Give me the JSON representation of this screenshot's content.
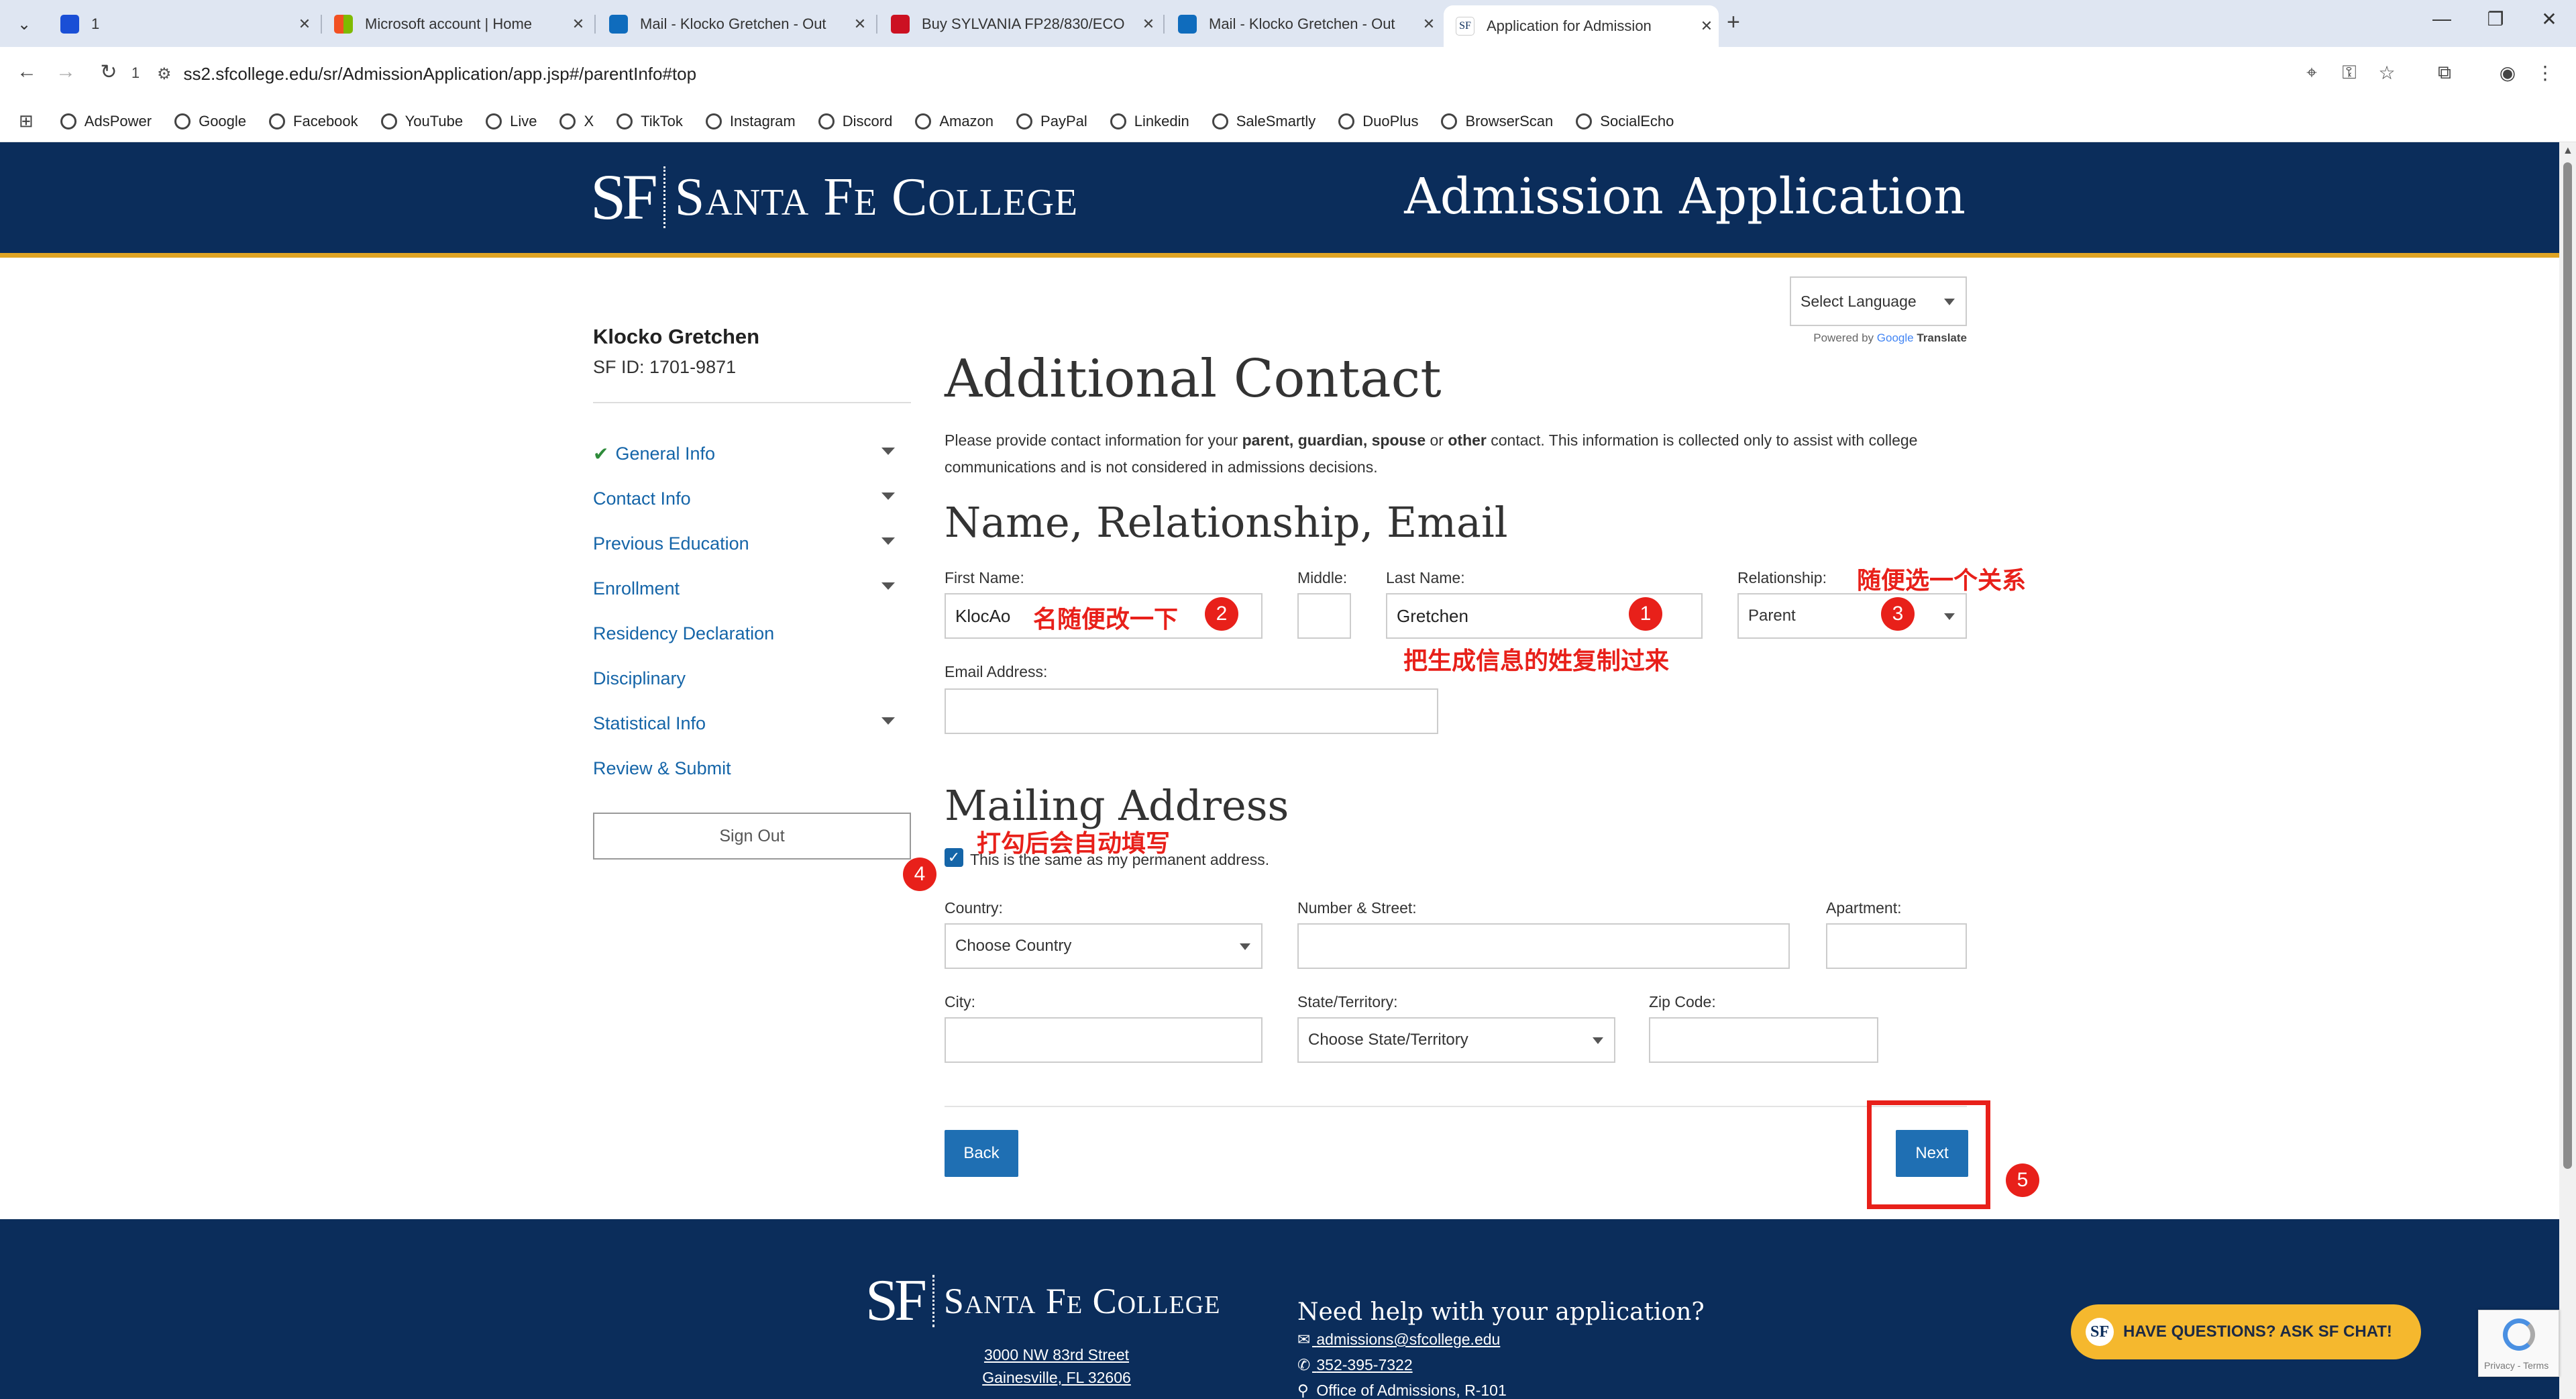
{
  "browser": {
    "tabs": [
      {
        "title": "1",
        "favicon_color": "#1a4fd6"
      },
      {
        "title": "Microsoft account | Home",
        "favicon_color": "#f25022"
      },
      {
        "title": "Mail - Klocko Gretchen - Out",
        "favicon_color": "#0f6cbd"
      },
      {
        "title": "Buy SYLVANIA FP28/830/ECO",
        "favicon_color": "#cc1122"
      },
      {
        "title": "Mail - Klocko Gretchen - Out",
        "favicon_color": "#0f6cbd"
      },
      {
        "title": "Application for Admission",
        "favicon_color": "#ffffff"
      }
    ],
    "url": "ss2.sfcollege.edu/sr/AdmissionApplication/app.jsp#/parentInfo#top",
    "reload_count": "1",
    "bookmarks": [
      "AdsPower",
      "Google",
      "Facebook",
      "YouTube",
      "Live",
      "X",
      "TikTok",
      "Instagram",
      "Discord",
      "Amazon",
      "PayPal",
      "Linkedin",
      "SaleSmartly",
      "DuoPlus",
      "BrowserScan",
      "SocialEcho"
    ]
  },
  "header": {
    "logo_mark": "SF",
    "logo_name": "Santa Fe College",
    "title": "Admission Application"
  },
  "sidebar": {
    "user_name": "Klocko Gretchen",
    "sf_id": "SF ID: 1701-9871",
    "items": [
      {
        "label": "General Info",
        "done": true,
        "expandable": true
      },
      {
        "label": "Contact Info",
        "done": false,
        "expandable": true
      },
      {
        "label": "Previous Education",
        "done": false,
        "expandable": true
      },
      {
        "label": "Enrollment",
        "done": false,
        "expandable": true
      },
      {
        "label": "Residency Declaration",
        "done": false,
        "expandable": false
      },
      {
        "label": "Disciplinary",
        "done": false,
        "expandable": false
      },
      {
        "label": "Statistical Info",
        "done": false,
        "expandable": true
      },
      {
        "label": "Review & Submit",
        "done": false,
        "expandable": false
      }
    ],
    "sign_out": "Sign Out"
  },
  "translate": {
    "select_label": "Select Language",
    "powered_by": "Powered by",
    "google": "Google",
    "translate": "Translate"
  },
  "main": {
    "title": "Additional Contact",
    "intro_prefix": "Please provide contact information for your ",
    "intro_b1": "parent, guardian, spouse",
    "intro_mid": " or ",
    "intro_b2": "other",
    "intro_suffix": " contact. This information is collected only to assist with college communications and is not considered in admissions decisions.",
    "section1": "Name, Relationship, Email",
    "first_name_label": "First Name:",
    "first_name_value": "KlocAo",
    "middle_label": "Middle:",
    "middle_value": "",
    "last_name_label": "Last Name:",
    "last_name_value": "Gretchen",
    "relationship_label": "Relationship:",
    "relationship_value": "Parent",
    "email_label": "Email Address:",
    "email_value": "",
    "section2": "Mailing Address",
    "same_address_label": "This is the same as my permanent address.",
    "same_address_checked": true,
    "country_label": "Country:",
    "country_value": "Choose Country",
    "street_label": "Number & Street:",
    "street_value": "",
    "apartment_label": "Apartment:",
    "apartment_value": "",
    "city_label": "City:",
    "city_value": "",
    "state_label": "State/Territory:",
    "state_value": "Choose State/Territory",
    "zip_label": "Zip Code:",
    "zip_value": "",
    "back_label": "Back",
    "next_label": "Next"
  },
  "annotations": {
    "first_name_note": "名随便改一下",
    "last_name_note": "把生成信息的姓复制过来",
    "relationship_note": "随便选一个关系",
    "checkbox_note": "打勾后会自动填写",
    "badges": [
      "1",
      "2",
      "3",
      "4",
      "5"
    ],
    "color": "#e8201a"
  },
  "footer": {
    "logo_mark": "SF",
    "logo_name": "Santa Fe College",
    "address_line1": "3000 NW 83rd Street",
    "address_line2": "Gainesville, FL 32606",
    "help_title": "Need help with your application?",
    "email": "admissions@sfcollege.edu",
    "phone": "352-395-7322",
    "office": "Office of Admissions, R-101"
  },
  "chat": {
    "label": "HAVE QUESTIONS? ASK SF CHAT!",
    "icon_text": "SF"
  },
  "recaptcha": {
    "text": "Privacy - Terms"
  },
  "colors": {
    "brand_navy": "#0b2d5b",
    "brand_gold": "#e0a423",
    "link_blue": "#1565a8",
    "button_blue": "#1f6fb3"
  }
}
